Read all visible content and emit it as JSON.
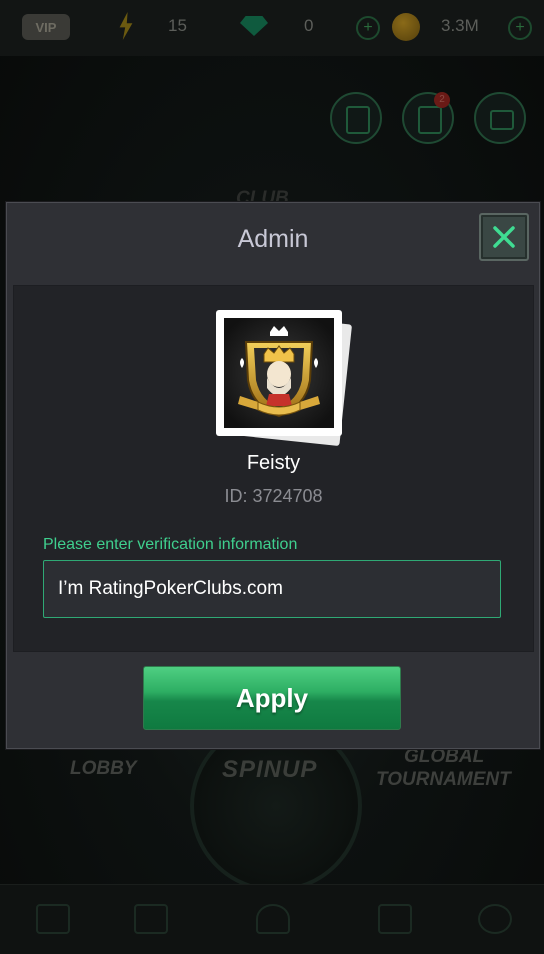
{
  "background": {
    "vip_label": "VIP",
    "energy": "15",
    "gems": "0",
    "coins": "3.3M",
    "club_label": "CLUB",
    "notification_count": "2",
    "lobby_label": "LOBBY",
    "spinup_label": "SPINUP",
    "global_label": "GLOBAL",
    "tournament_label": "TOURNAMENT"
  },
  "dialog": {
    "title": "Admin",
    "close_icon": "close-icon",
    "player": {
      "name": "Feisty",
      "id_text": "ID: 3724708",
      "avatar_icon": "king-of-spades-crest"
    },
    "verification": {
      "label": "Please enter verification information",
      "value": "I’m RatingPokerClubs.com",
      "placeholder": ""
    },
    "apply_label": "Apply"
  },
  "colors": {
    "accent_green": "#3fcf8e",
    "apply_green": "#1d9a55",
    "dialog_bg": "#2f3035"
  }
}
